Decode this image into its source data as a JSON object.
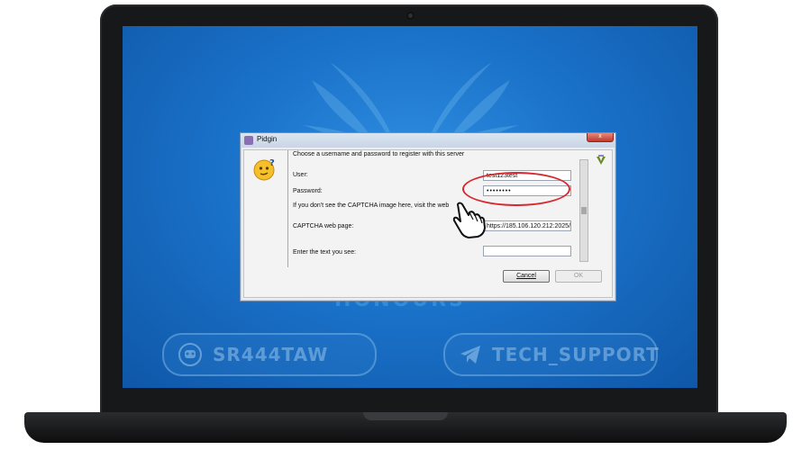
{
  "background": {
    "hidden_word": "HONOURS",
    "left_badge": {
      "icon": "chat-robot-icon",
      "label": "SR444TAW"
    },
    "right_badge": {
      "icon": "telegram-icon",
      "label": "TECH_SUPPORT"
    }
  },
  "dialog": {
    "title": "Pidgin",
    "close_glyph": "x",
    "instructions": "Choose a username and password to register with this server",
    "user_label": "User:",
    "user_value": "test123test",
    "password_label": "Password:",
    "password_value": "••••••••",
    "captcha_note": "If you don't see the CAPTCHA image here, visit the web",
    "captcha_page_label": "CAPTCHA web page:",
    "captcha_page_value": "https://185.106.120.212:2025/",
    "enter_text_label": "Enter the text you see:",
    "enter_text_value": "",
    "cancel_label": "Cancel",
    "ok_label": "OK"
  },
  "colors": {
    "screen_accent": "#1a72c9",
    "highlight": "#d8282f"
  }
}
